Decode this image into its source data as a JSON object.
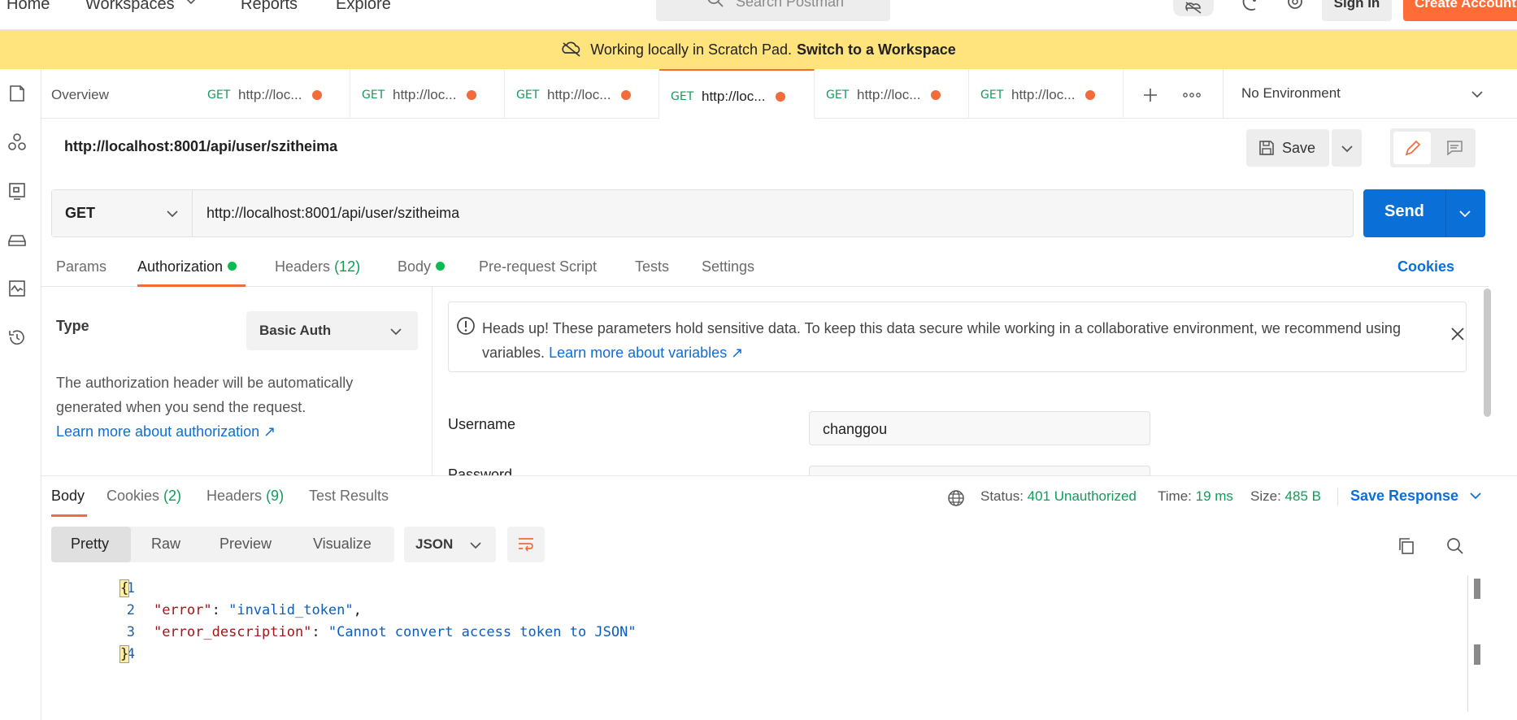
{
  "topnav": {
    "home": "Home",
    "workspaces": "Workspaces",
    "reports": "Reports",
    "explore": "Explore",
    "search_placeholder": "Search Postman",
    "sign_in": "Sign In",
    "create_account": "Create Account"
  },
  "banner": {
    "text": "Working locally in Scratch Pad.",
    "link": "Switch to a Workspace"
  },
  "tabs": {
    "overview": "Overview",
    "items": [
      {
        "method": "GET",
        "url": "http://loc..."
      },
      {
        "method": "GET",
        "url": "http://loc..."
      },
      {
        "method": "GET",
        "url": "http://loc..."
      },
      {
        "method": "GET",
        "url": "http://loc..."
      },
      {
        "method": "GET",
        "url": "http://loc..."
      },
      {
        "method": "GET",
        "url": "http://loc..."
      }
    ],
    "environment": "No Environment"
  },
  "request": {
    "title": "http://localhost:8001/api/user/szitheima",
    "save_label": "Save",
    "method": "GET",
    "url": "http://localhost:8001/api/user/szitheima",
    "send_label": "Send"
  },
  "request_tabs": {
    "params": "Params",
    "authorization": "Authorization",
    "headers": "Headers",
    "headers_count": "(12)",
    "body": "Body",
    "prerequest": "Pre-request Script",
    "tests": "Tests",
    "settings": "Settings",
    "cookies": "Cookies"
  },
  "auth": {
    "type_label": "Type",
    "type_value": "Basic Auth",
    "description": "The authorization header will be automatically generated when you send the request.",
    "learn_more": "Learn more about authorization ↗",
    "alert_text": "Heads up! These parameters hold sensitive data. To keep this data secure while working in a collaborative environment, we recommend using variables.",
    "alert_link": "Learn more about variables ↗",
    "username_label": "Username",
    "username_value": "changgou",
    "password_label": "Password"
  },
  "response": {
    "body": "Body",
    "cookies": "Cookies",
    "cookies_count": "(2)",
    "headers": "Headers",
    "headers_count": "(9)",
    "test_results": "Test Results",
    "status_label": "Status:",
    "status_value": "401 Unauthorized",
    "time_label": "Time:",
    "time_value": "19 ms",
    "size_label": "Size:",
    "size_value": "485 B",
    "save_response": "Save Response",
    "formats": [
      "Pretty",
      "Raw",
      "Preview",
      "Visualize"
    ],
    "language": "JSON",
    "lines": [
      {
        "n": "1",
        "text": "{"
      },
      {
        "n": "2",
        "key": "\"error\"",
        "value": "\"invalid_token\"",
        "trail": ","
      },
      {
        "n": "3",
        "key": "\"error_description\"",
        "value": "\"Cannot convert access token to JSON\"",
        "trail": ""
      },
      {
        "n": "4",
        "text": "}"
      }
    ]
  },
  "colors": {
    "accent": "#f26b3a",
    "brand": "#ff6c37",
    "banner": "#ffe47e",
    "send": "#0b6fd8",
    "ok_green": "#0f9d58"
  }
}
